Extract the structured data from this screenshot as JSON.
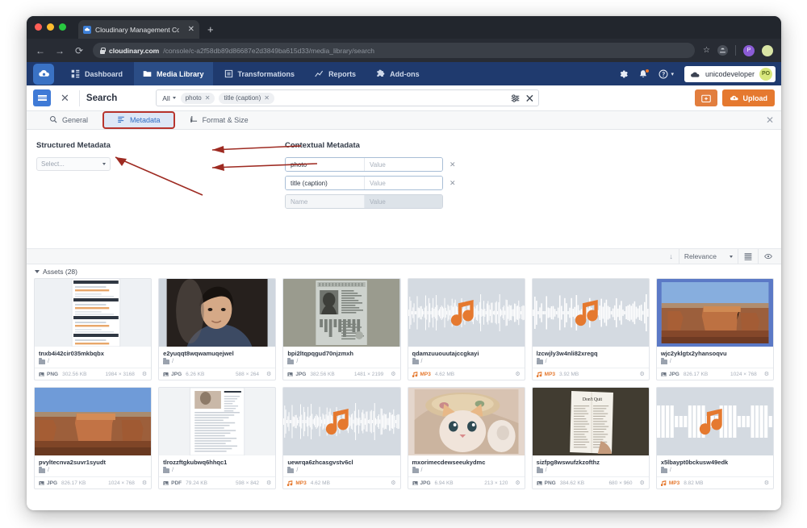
{
  "browser": {
    "tab": {
      "title": "Cloudinary Management Console",
      "close": "✕",
      "new_tab": "+"
    },
    "nav": {
      "back": "←",
      "forward": "→",
      "reload": "⟳"
    },
    "url": {
      "host": "cloudinary.com",
      "path": "/console/c-a2f58db89d86687e2d3849ba615d33/media_library/search"
    },
    "profile_initial": "P"
  },
  "topnav": {
    "items": [
      {
        "label": "Dashboard",
        "icon": "grid-icon",
        "active": false
      },
      {
        "label": "Media Library",
        "icon": "folder-icon",
        "active": true
      },
      {
        "label": "Transformations",
        "icon": "transform-icon",
        "active": false
      },
      {
        "label": "Reports",
        "icon": "chart-icon",
        "active": false
      },
      {
        "label": "Add-ons",
        "icon": "puzzle-icon",
        "active": false
      }
    ],
    "account_name": "unicodeveloper",
    "account_initials": "PO"
  },
  "header": {
    "title": "Search",
    "close_label": "✕",
    "scope": "All",
    "chips": [
      {
        "label": "photo",
        "remove": "✕"
      },
      {
        "label": "title (caption)",
        "remove": "✕"
      }
    ],
    "clear_label": "✕",
    "upload_label": "Upload"
  },
  "tabs": [
    {
      "label": "General",
      "icon": "search-icon",
      "selected": false
    },
    {
      "label": "Metadata",
      "icon": "list-icon",
      "selected": true
    },
    {
      "label": "Format & Size",
      "icon": "crop-icon",
      "selected": false
    }
  ],
  "tabs_close": "✕",
  "panel": {
    "structured": {
      "label": "Structured Metadata",
      "select_placeholder": "Select..."
    },
    "contextual": {
      "label": "Contextual Metadata",
      "rows": [
        {
          "name": "photo",
          "value": "",
          "value_placeholder": "Value",
          "remove": "✕",
          "empty": false
        },
        {
          "name": "title (caption)",
          "value": "",
          "value_placeholder": "Value",
          "remove": "✕",
          "empty": false
        },
        {
          "name": "",
          "name_placeholder": "Name",
          "value": "",
          "value_placeholder": "Value",
          "remove": "",
          "empty": true
        }
      ]
    }
  },
  "toolbar": {
    "sort_value": "Relevance",
    "assets_label": "Assets (28)"
  },
  "assets": [
    {
      "title": "tnxb4i42cir035mkbqbx",
      "folder": "/",
      "format": "PNG",
      "size": "302.56 KB",
      "dim": "1984 × 3168",
      "kind": "doc"
    },
    {
      "title": "e2yuqqt8wqwamuqejwel",
      "folder": "/",
      "format": "JPG",
      "size": "6.26 KB",
      "dim": "588 × 264",
      "kind": "portrait"
    },
    {
      "title": "bpi2ltqpqgud70njzmxh",
      "folder": "/",
      "format": "JPG",
      "size": "382.56 KB",
      "dim": "1481 × 2199",
      "kind": "passport"
    },
    {
      "title": "qdamzuuouutajccgkayi",
      "folder": "/",
      "format": "MP3",
      "size": "4.62 MB",
      "dim": "",
      "kind": "audio-dense"
    },
    {
      "title": "lzcwjly3w4nli82xregq",
      "folder": "/",
      "format": "MP3",
      "size": "3.92 MB",
      "dim": "",
      "kind": "audio-mid"
    },
    {
      "title": "wjc2yklgtx2yhansoqvu",
      "folder": "/",
      "format": "JPG",
      "size": "826.17 KB",
      "dim": "1024 × 768",
      "kind": "mesa"
    },
    {
      "title": "pvyltecnva2suvr1syudt",
      "folder": "/",
      "format": "JPG",
      "size": "826.17 KB",
      "dim": "1024 × 768",
      "kind": "mesa2"
    },
    {
      "title": "tlrozzftgkubwq6hhqc1",
      "folder": "/",
      "format": "PDF",
      "size": "79.24 KB",
      "dim": "598 × 842",
      "kind": "pdfpage"
    },
    {
      "title": "uewrqa6zhcasgvstv6cl",
      "folder": "/",
      "format": "MP3",
      "size": "4.62 MB",
      "dim": "",
      "kind": "audio-dense2"
    },
    {
      "title": "mxorimecdewseeukydmc",
      "folder": "/",
      "format": "JPG",
      "size": "6.94 KB",
      "dim": "213 × 120",
      "kind": "kitten"
    },
    {
      "title": "sizfpg8wswufzkzofthz",
      "folder": "/",
      "format": "PNG",
      "size": "384.62 KB",
      "dim": "680 × 960",
      "kind": "book"
    },
    {
      "title": "x5lbaypt0bckusw49edk",
      "folder": "/",
      "format": "MP3",
      "size": "8.82 MB",
      "dim": "",
      "kind": "audio-block"
    }
  ],
  "colors": {
    "brand_navy": "#1f3a6e",
    "accent_orange": "#e5792f",
    "link_blue": "#2f6cc4",
    "annotation_red": "#9e2b22"
  }
}
